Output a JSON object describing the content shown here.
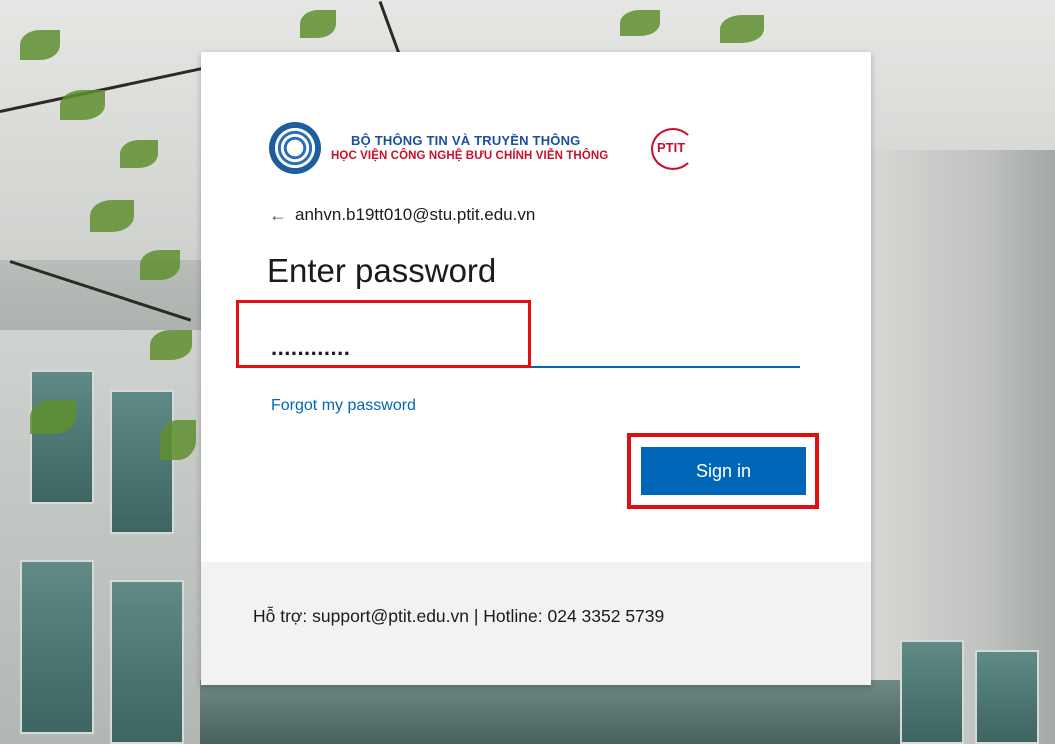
{
  "logo": {
    "line1": "BỘ THÔNG TIN VÀ TRUYỀN THÔNG",
    "line2": "HỌC VIỆN CÔNG NGHỆ BƯU CHÍNH VIỄN THÔNG",
    "badge": "PTIT"
  },
  "account": {
    "back_glyph": "←",
    "email": "anhvn.b19tt010@stu.ptit.edu.vn"
  },
  "title": "Enter password",
  "password": {
    "masked_value": "............",
    "placeholder": ""
  },
  "forgot_link": "Forgot my password",
  "signin_label": "Sign in",
  "footer": {
    "support_text": "Hỗ trợ: support@ptit.edu.vn | Hotline: 024 3352 5739"
  },
  "colors": {
    "accent": "#0067b8",
    "highlight": "#e01010",
    "brand_red": "#c8102e",
    "brand_blue": "#1b4f9b"
  }
}
